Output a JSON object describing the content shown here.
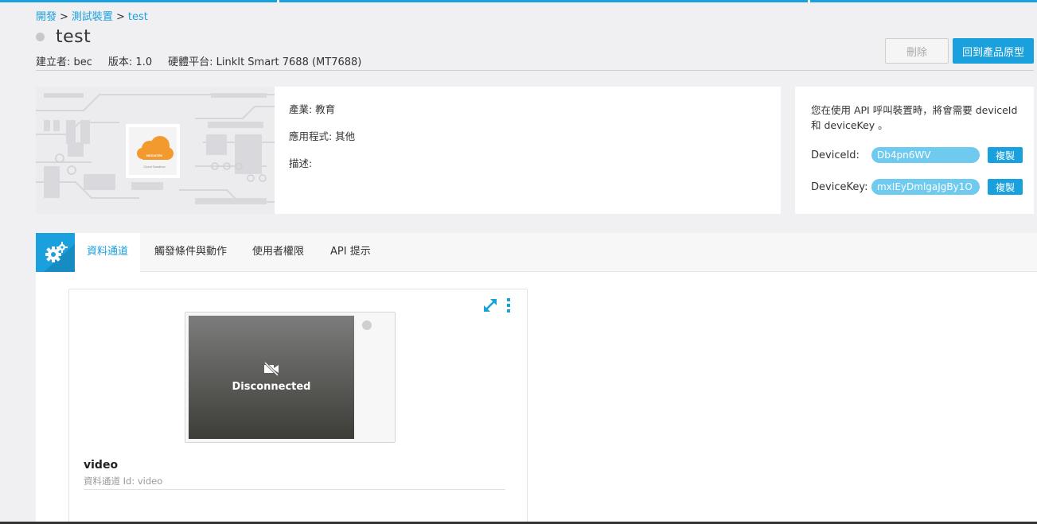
{
  "breadcrumb": {
    "items": [
      "開發",
      "測試裝置",
      "test"
    ],
    "separator": ">"
  },
  "device": {
    "title": "test",
    "creator_label": "建立者: bec",
    "version_label": "版本: 1.0",
    "hardware_label": "硬體平台: LinkIt Smart 7688 (MT7688)"
  },
  "actions": {
    "delete_label": "刪除",
    "back_label": "回到產品原型"
  },
  "info": {
    "industry": "產業: 教育",
    "application": "應用程式: 其他",
    "description": "描述:"
  },
  "image": {
    "brand_text": "MEDIATEK",
    "caption": "Cloud Sandbox"
  },
  "keys": {
    "description": "您在使用 API 呼叫裝置時，將會需要 deviceId 和 deviceKey 。",
    "device_id_label": "DeviceId:",
    "device_id_value": "Db4pn6WV",
    "device_key_label": "DeviceKey:",
    "device_key_value": "mxIEyDmlgaJgBy1O",
    "copy_label": "複製"
  },
  "tabs": [
    {
      "label": "資料通道",
      "active": true
    },
    {
      "label": "觸發條件與動作",
      "active": false
    },
    {
      "label": "使用者權限",
      "active": false
    },
    {
      "label": "API 提示",
      "active": false
    }
  ],
  "widget": {
    "status_text": "Disconnected",
    "title": "video",
    "subtitle": "資料通道 Id: video"
  },
  "colors": {
    "accent": "#1aa0dc",
    "pill": "#6fcaef"
  },
  "icons": [
    "gear-icon",
    "video-off-icon",
    "expand-icon",
    "more-vertical-icon"
  ]
}
